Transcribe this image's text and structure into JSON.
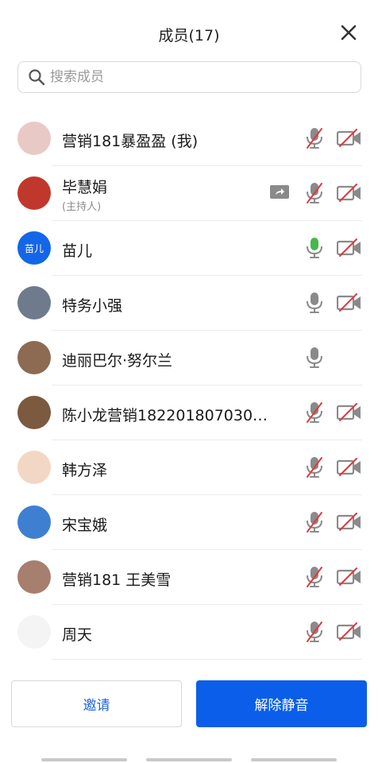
{
  "header": {
    "title": "成员(17)",
    "close_icon": "close-icon"
  },
  "search": {
    "placeholder": "搜索成员",
    "value": "",
    "icon": "search-icon"
  },
  "members": [
    {
      "name": "营销181暴盈盈 (我)",
      "role": "",
      "avatar_color": "#e9c9c6",
      "avatar_text": "",
      "screen_share": false,
      "mic": "muted",
      "camera": "off"
    },
    {
      "name": "毕慧娟",
      "role": "(主持人)",
      "avatar_color": "#c0382b",
      "avatar_text": "",
      "screen_share": true,
      "mic": "muted",
      "camera": "off"
    },
    {
      "name": "苗儿",
      "role": "",
      "avatar_color": "#1466e8",
      "avatar_text": "苗儿",
      "screen_share": false,
      "mic": "active",
      "camera": "off"
    },
    {
      "name": "特务小强",
      "role": "",
      "avatar_color": "#6f7a8c",
      "avatar_text": "",
      "screen_share": false,
      "mic": "on",
      "camera": "off"
    },
    {
      "name": "迪丽巴尔·努尔兰",
      "role": "",
      "avatar_color": "#8d6a52",
      "avatar_text": "",
      "screen_share": false,
      "mic": "on",
      "camera": "none"
    },
    {
      "name": "陈小龙营销182201807030…",
      "role": "",
      "avatar_color": "#7b5a3f",
      "avatar_text": "",
      "screen_share": false,
      "mic": "muted",
      "camera": "off"
    },
    {
      "name": "韩方泽",
      "role": "",
      "avatar_color": "#f2d8c4",
      "avatar_text": "",
      "screen_share": false,
      "mic": "muted",
      "camera": "off"
    },
    {
      "name": "宋宝娥",
      "role": "",
      "avatar_color": "#3f7fd1",
      "avatar_text": "",
      "screen_share": false,
      "mic": "muted",
      "camera": "off"
    },
    {
      "name": "营销181 王美雪",
      "role": "",
      "avatar_color": "#a67f6e",
      "avatar_text": "",
      "screen_share": false,
      "mic": "muted",
      "camera": "off"
    },
    {
      "name": "周天",
      "role": "",
      "avatar_color": "#f4f4f4",
      "avatar_text": "",
      "screen_share": false,
      "mic": "muted",
      "camera": "off"
    }
  ],
  "footer": {
    "invite_label": "邀请",
    "unmute_all_label": "解除静音"
  },
  "colors": {
    "accent": "#0b5ee9",
    "link": "#1c66e0",
    "muted_slash": "#e0393e",
    "mic_active": "#45b84a",
    "icon_gray": "#8a8a8a"
  }
}
